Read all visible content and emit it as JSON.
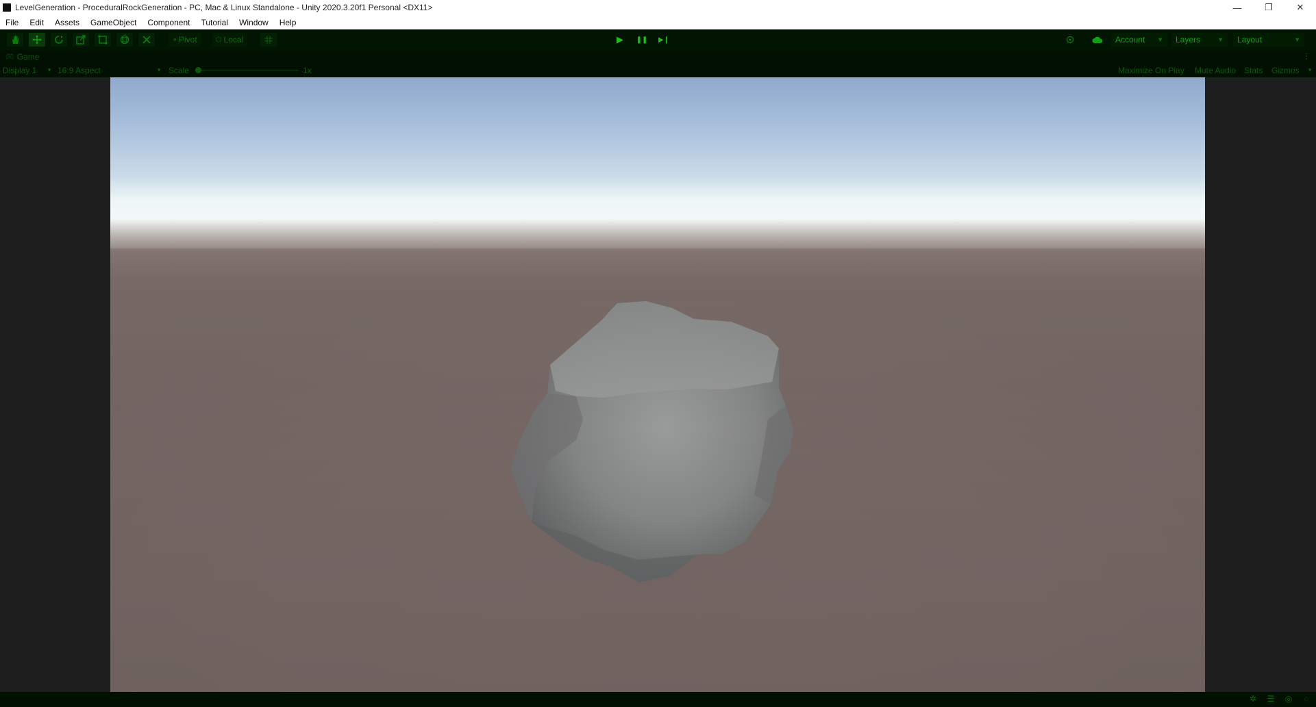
{
  "window": {
    "title": "LevelGeneration - ProceduralRockGeneration - PC, Mac & Linux Standalone - Unity 2020.3.20f1 Personal <DX11>",
    "minimize": "—",
    "restore": "❐",
    "close": "✕"
  },
  "menu": [
    "File",
    "Edit",
    "Assets",
    "GameObject",
    "Component",
    "Tutorial",
    "Window",
    "Help"
  ],
  "toolbar": {
    "pivot_label": "Pivot",
    "local_label": "Local",
    "play_icon": "▶",
    "pause_icon": "❚❚",
    "step_icon": "▶❙",
    "account_label": "Account",
    "layers_label": "Layers",
    "layout_label": "Layout"
  },
  "game_view": {
    "tab_label": "Game",
    "display_label": "Display 1",
    "aspect_label": "16:9 Aspect",
    "scale_label": "Scale",
    "scale_value": "1x",
    "maximize_label": "Maximize On Play",
    "mute_label": "Mute Audio",
    "stats_label": "Stats",
    "gizmos_label": "Gizmos"
  },
  "colors": {
    "accent_green": "#14a014",
    "toolbar_bg": "#021402",
    "sky_top": "#90a8cc",
    "ground": "#766865",
    "rock": "#8c8d8d"
  }
}
